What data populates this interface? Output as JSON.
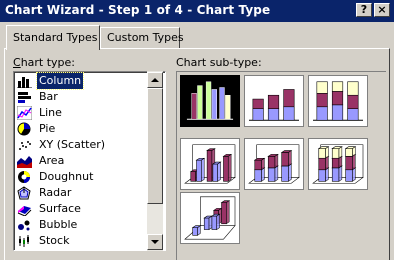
{
  "window": {
    "title": "Chart Wizard - Step 1 of 4 - Chart Type",
    "help_label": "?",
    "close_label": "×"
  },
  "tabs": [
    {
      "label": "Standard Types",
      "active": true
    },
    {
      "label": "Custom Types",
      "active": false
    }
  ],
  "chart_type": {
    "label": "Chart type:",
    "selected": "Column",
    "items": [
      {
        "label": "Column",
        "icon": "column-chart-icon"
      },
      {
        "label": "Bar",
        "icon": "bar-chart-icon"
      },
      {
        "label": "Line",
        "icon": "line-chart-icon"
      },
      {
        "label": "Pie",
        "icon": "pie-chart-icon"
      },
      {
        "label": "XY (Scatter)",
        "icon": "scatter-chart-icon"
      },
      {
        "label": "Area",
        "icon": "area-chart-icon"
      },
      {
        "label": "Doughnut",
        "icon": "doughnut-chart-icon"
      },
      {
        "label": "Radar",
        "icon": "radar-chart-icon"
      },
      {
        "label": "Surface",
        "icon": "surface-chart-icon"
      },
      {
        "label": "Bubble",
        "icon": "bubble-chart-icon"
      },
      {
        "label": "Stock",
        "icon": "stock-chart-icon"
      }
    ]
  },
  "chart_subtype": {
    "label": "Chart sub-type:",
    "selected_index": 0,
    "items": [
      {
        "name": "clustered-column"
      },
      {
        "name": "stacked-column"
      },
      {
        "name": "100-percent-stacked-column"
      },
      {
        "name": "3d-clustered-column"
      },
      {
        "name": "3d-stacked-column"
      },
      {
        "name": "3d-100-percent-stacked-column"
      },
      {
        "name": "3d-column"
      }
    ]
  },
  "colors": {
    "titlebar": "#0a246a",
    "selection": "#0a246a",
    "face": "#d4d0c8",
    "series_maroon": "#993366",
    "series_lavender": "#9999ff",
    "series_cream": "#ffffcc",
    "series_green": "#ccff99"
  }
}
